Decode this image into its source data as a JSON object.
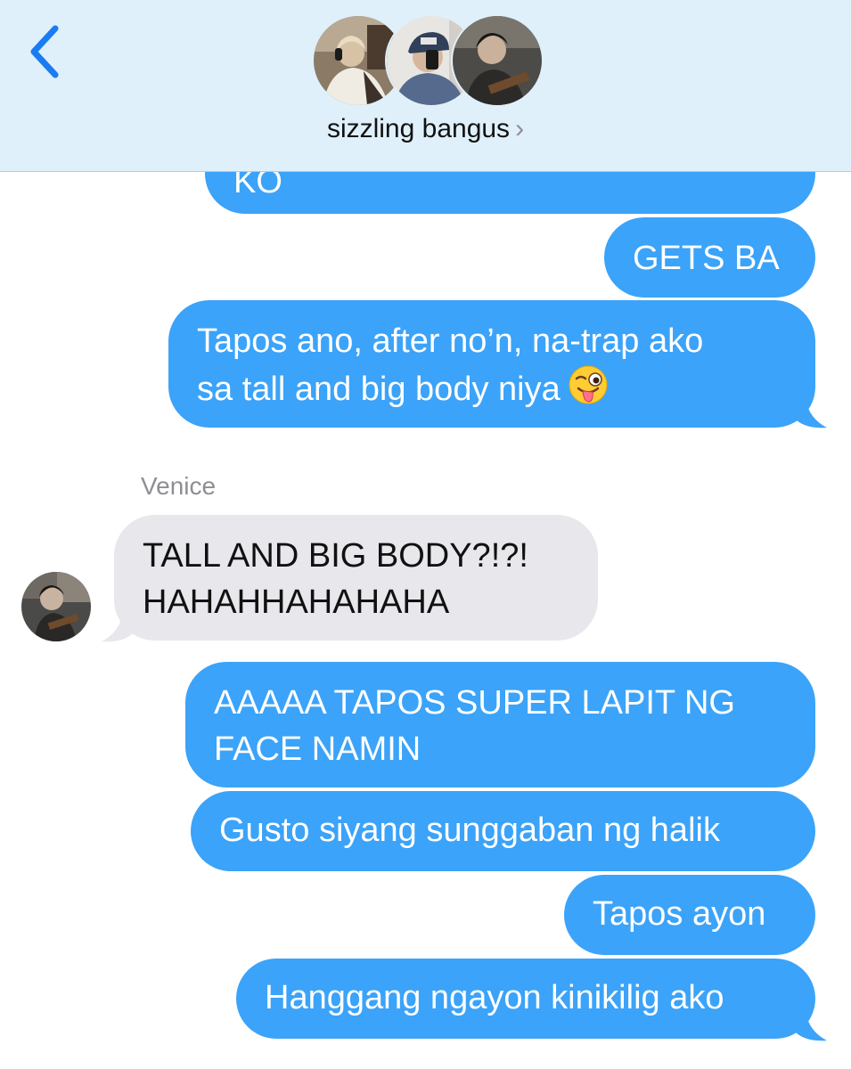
{
  "header": {
    "group_name": "sizzling bangus",
    "chevron": "›",
    "back_icon": "chevron-left-icon",
    "avatars": [
      "member-photo-1",
      "member-photo-2",
      "member-photo-3"
    ]
  },
  "colors": {
    "header_bg": "#dff0fb",
    "outgoing_bubble": "#3ba3f9",
    "incoming_bubble": "#e7e7ec",
    "back_icon": "#1a7cf0"
  },
  "messages": [
    {
      "direction": "out",
      "lines": [
        "KO"
      ]
    },
    {
      "direction": "out",
      "lines": [
        "GETS BA"
      ]
    },
    {
      "direction": "out",
      "lines": [
        "Tapos ano, after no’n, na-trap ako",
        "sa tall and big body niya"
      ],
      "emoji": "winking-face-with-tongue"
    },
    {
      "direction": "in",
      "sender": "Venice",
      "lines": [
        "TALL AND BIG BODY?!?!",
        "HAHAHHAHAHAHA"
      ]
    },
    {
      "direction": "out",
      "lines": [
        "AAAAA TAPOS SUPER LAPIT NG",
        "FACE NAMIN"
      ]
    },
    {
      "direction": "out",
      "lines": [
        "Gusto siyang sunggaban ng halik"
      ]
    },
    {
      "direction": "out",
      "lines": [
        "Tapos ayon"
      ]
    },
    {
      "direction": "out",
      "lines": [
        "Hanggang ngayon kinikilig ako"
      ]
    }
  ]
}
